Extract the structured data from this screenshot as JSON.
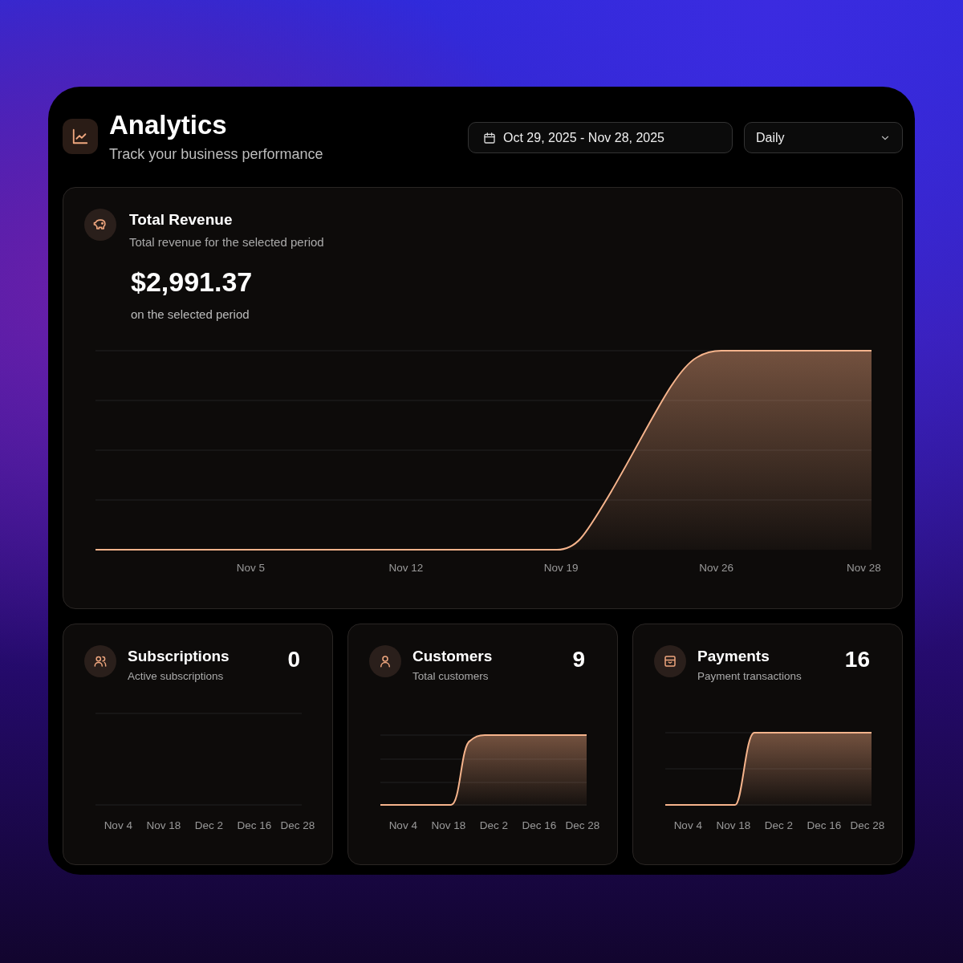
{
  "header": {
    "title": "Analytics",
    "subtitle": "Track your business performance",
    "date_range": "Oct 29, 2025 - Nov 28, 2025",
    "interval": "Daily"
  },
  "revenue": {
    "title": "Total Revenue",
    "subtitle": "Total revenue for the selected period",
    "value": "$2,991.37",
    "caption": "on the selected period",
    "x_labels": [
      "Nov 5",
      "Nov 12",
      "Nov 19",
      "Nov 26",
      "Nov 28"
    ]
  },
  "stats": [
    {
      "kind": "subscriptions",
      "title": "Subscriptions",
      "subtitle": "Active subscriptions",
      "value": "0",
      "x_labels": [
        "Nov 4",
        "Nov 18",
        "Dec 2",
        "Dec 16",
        "Dec 28"
      ]
    },
    {
      "kind": "customers",
      "title": "Customers",
      "subtitle": "Total customers",
      "value": "9",
      "x_labels": [
        "Nov 4",
        "Nov 18",
        "Dec 2",
        "Dec 16",
        "Dec 28"
      ]
    },
    {
      "kind": "payments",
      "title": "Payments",
      "subtitle": "Payment transactions",
      "value": "16",
      "x_labels": [
        "Nov 4",
        "Nov 18",
        "Dec 2",
        "Dec 16",
        "Dec 28"
      ]
    }
  ]
}
